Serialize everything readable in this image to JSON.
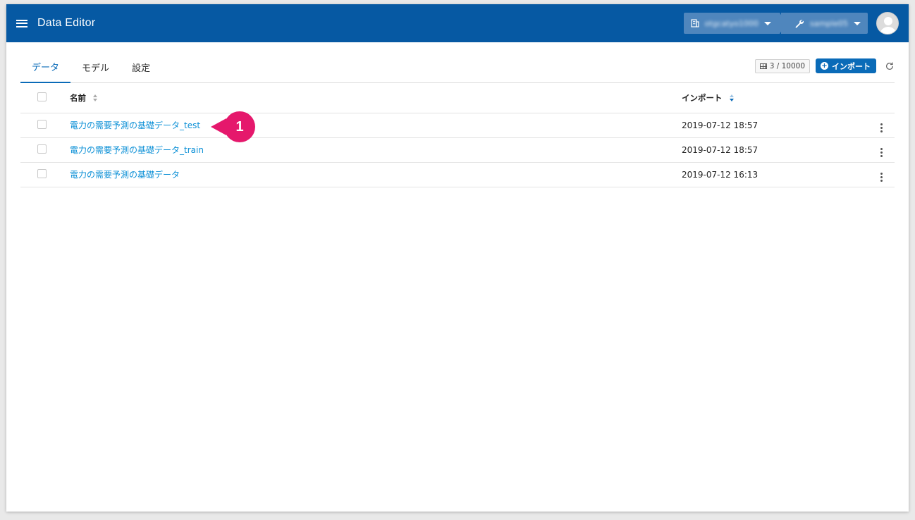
{
  "app": {
    "title": "Data Editor"
  },
  "header": {
    "organization": "otgcatyo1000",
    "project": "sample05"
  },
  "tabs": [
    {
      "label": "データ"
    },
    {
      "label": "モデル"
    },
    {
      "label": "設定"
    }
  ],
  "toolbar": {
    "quota": "3 / 10000",
    "import_label": "インポート"
  },
  "table": {
    "columns": {
      "name": "名前",
      "import": "インポート"
    },
    "rows": [
      {
        "name": "電力の需要予測の基礎データ_test",
        "date": "2019-07-12 18:57"
      },
      {
        "name": "電力の需要予測の基礎データ_train",
        "date": "2019-07-12 18:57"
      },
      {
        "name": "電力の需要予測の基礎データ",
        "date": "2019-07-12 16:13"
      }
    ]
  },
  "callout": {
    "number": "1"
  },
  "colors": {
    "appbar": "#0659a3",
    "accent": "#0a6bb8",
    "link": "#0a8fd6",
    "callout": "#e5186c"
  }
}
